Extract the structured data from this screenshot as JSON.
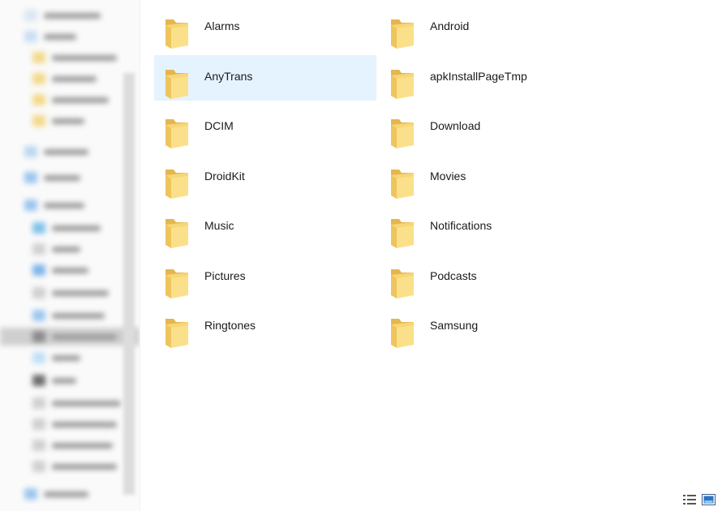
{
  "window": {
    "background": "#ffffff"
  },
  "selection_color": "#e5f3ff",
  "folders": [
    {
      "name": "Alarms",
      "selected": false
    },
    {
      "name": "Android",
      "selected": false
    },
    {
      "name": "AnyTrans",
      "selected": true
    },
    {
      "name": "apkInstallPageTmp",
      "selected": false
    },
    {
      "name": "DCIM",
      "selected": false
    },
    {
      "name": "Download",
      "selected": false
    },
    {
      "name": "DroidKit",
      "selected": false
    },
    {
      "name": "Movies",
      "selected": false
    },
    {
      "name": "Music",
      "selected": false
    },
    {
      "name": "Notifications",
      "selected": false
    },
    {
      "name": "Pictures",
      "selected": false
    },
    {
      "name": "Podcasts",
      "selected": false
    },
    {
      "name": "Ringtones",
      "selected": false
    },
    {
      "name": "Samsung",
      "selected": false
    }
  ],
  "view_buttons": [
    {
      "icon": "details-view-icon",
      "active": false
    },
    {
      "icon": "large-icons-view-icon",
      "active": true
    }
  ]
}
